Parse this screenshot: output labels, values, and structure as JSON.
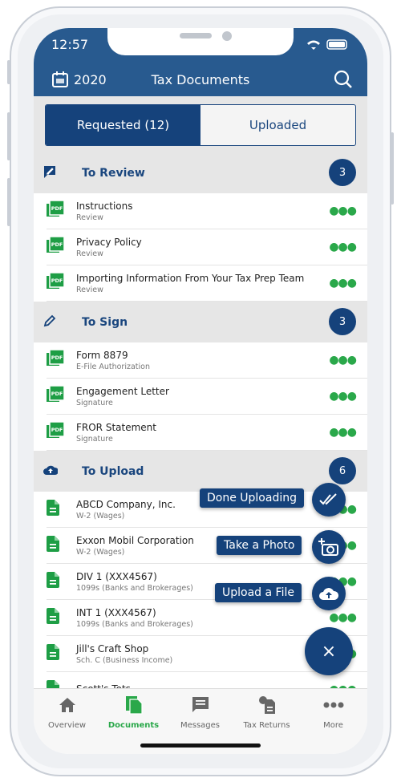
{
  "status": {
    "time": "12:57"
  },
  "header": {
    "year": "2020",
    "title": "Tax Documents"
  },
  "tabs": [
    {
      "label": "Requested (12)",
      "active": true
    },
    {
      "label": "Uploaded",
      "active": false
    }
  ],
  "sections": [
    {
      "title": "To Review",
      "count": "3",
      "icon": "review-icon",
      "items": [
        {
          "title": "Instructions",
          "subtitle": "Review"
        },
        {
          "title": "Privacy Policy",
          "subtitle": "Review"
        },
        {
          "title": "Importing Information From Your Tax Prep Team",
          "subtitle": "Review"
        }
      ]
    },
    {
      "title": "To Sign",
      "count": "3",
      "icon": "pencil-icon",
      "items": [
        {
          "title": "Form 8879",
          "subtitle": "E-File Authorization"
        },
        {
          "title": "Engagement Letter",
          "subtitle": "Signature"
        },
        {
          "title": "FROR Statement",
          "subtitle": "Signature"
        }
      ]
    },
    {
      "title": "To Upload",
      "count": "6",
      "icon": "cloud-upload-icon",
      "items": [
        {
          "title": "ABCD Company, Inc.",
          "subtitle": "W-2 (Wages)"
        },
        {
          "title": "Exxon Mobil Corporation",
          "subtitle": "W-2 (Wages)"
        },
        {
          "title": "DIV 1 (XXX4567)",
          "subtitle": "1099s (Banks and Brokerages)"
        },
        {
          "title": "INT 1 (XXX4567)",
          "subtitle": "1099s (Banks and Brokerages)"
        },
        {
          "title": "Jill's Craft Shop",
          "subtitle": "Sch. C (Business Income)"
        },
        {
          "title": "Scott's Tots",
          "subtitle": ""
        }
      ]
    }
  ],
  "fab_menu": {
    "done": "Done Uploading",
    "photo": "Take a Photo",
    "file": "Upload a File",
    "close": "×"
  },
  "bottom_nav": [
    {
      "label": "Overview"
    },
    {
      "label": "Documents",
      "active": true
    },
    {
      "label": "Messages"
    },
    {
      "label": "Tax Returns"
    },
    {
      "label": "More"
    }
  ],
  "colors": {
    "primary": "#15427b",
    "header": "#285a8f",
    "accent": "#2aa84a"
  }
}
